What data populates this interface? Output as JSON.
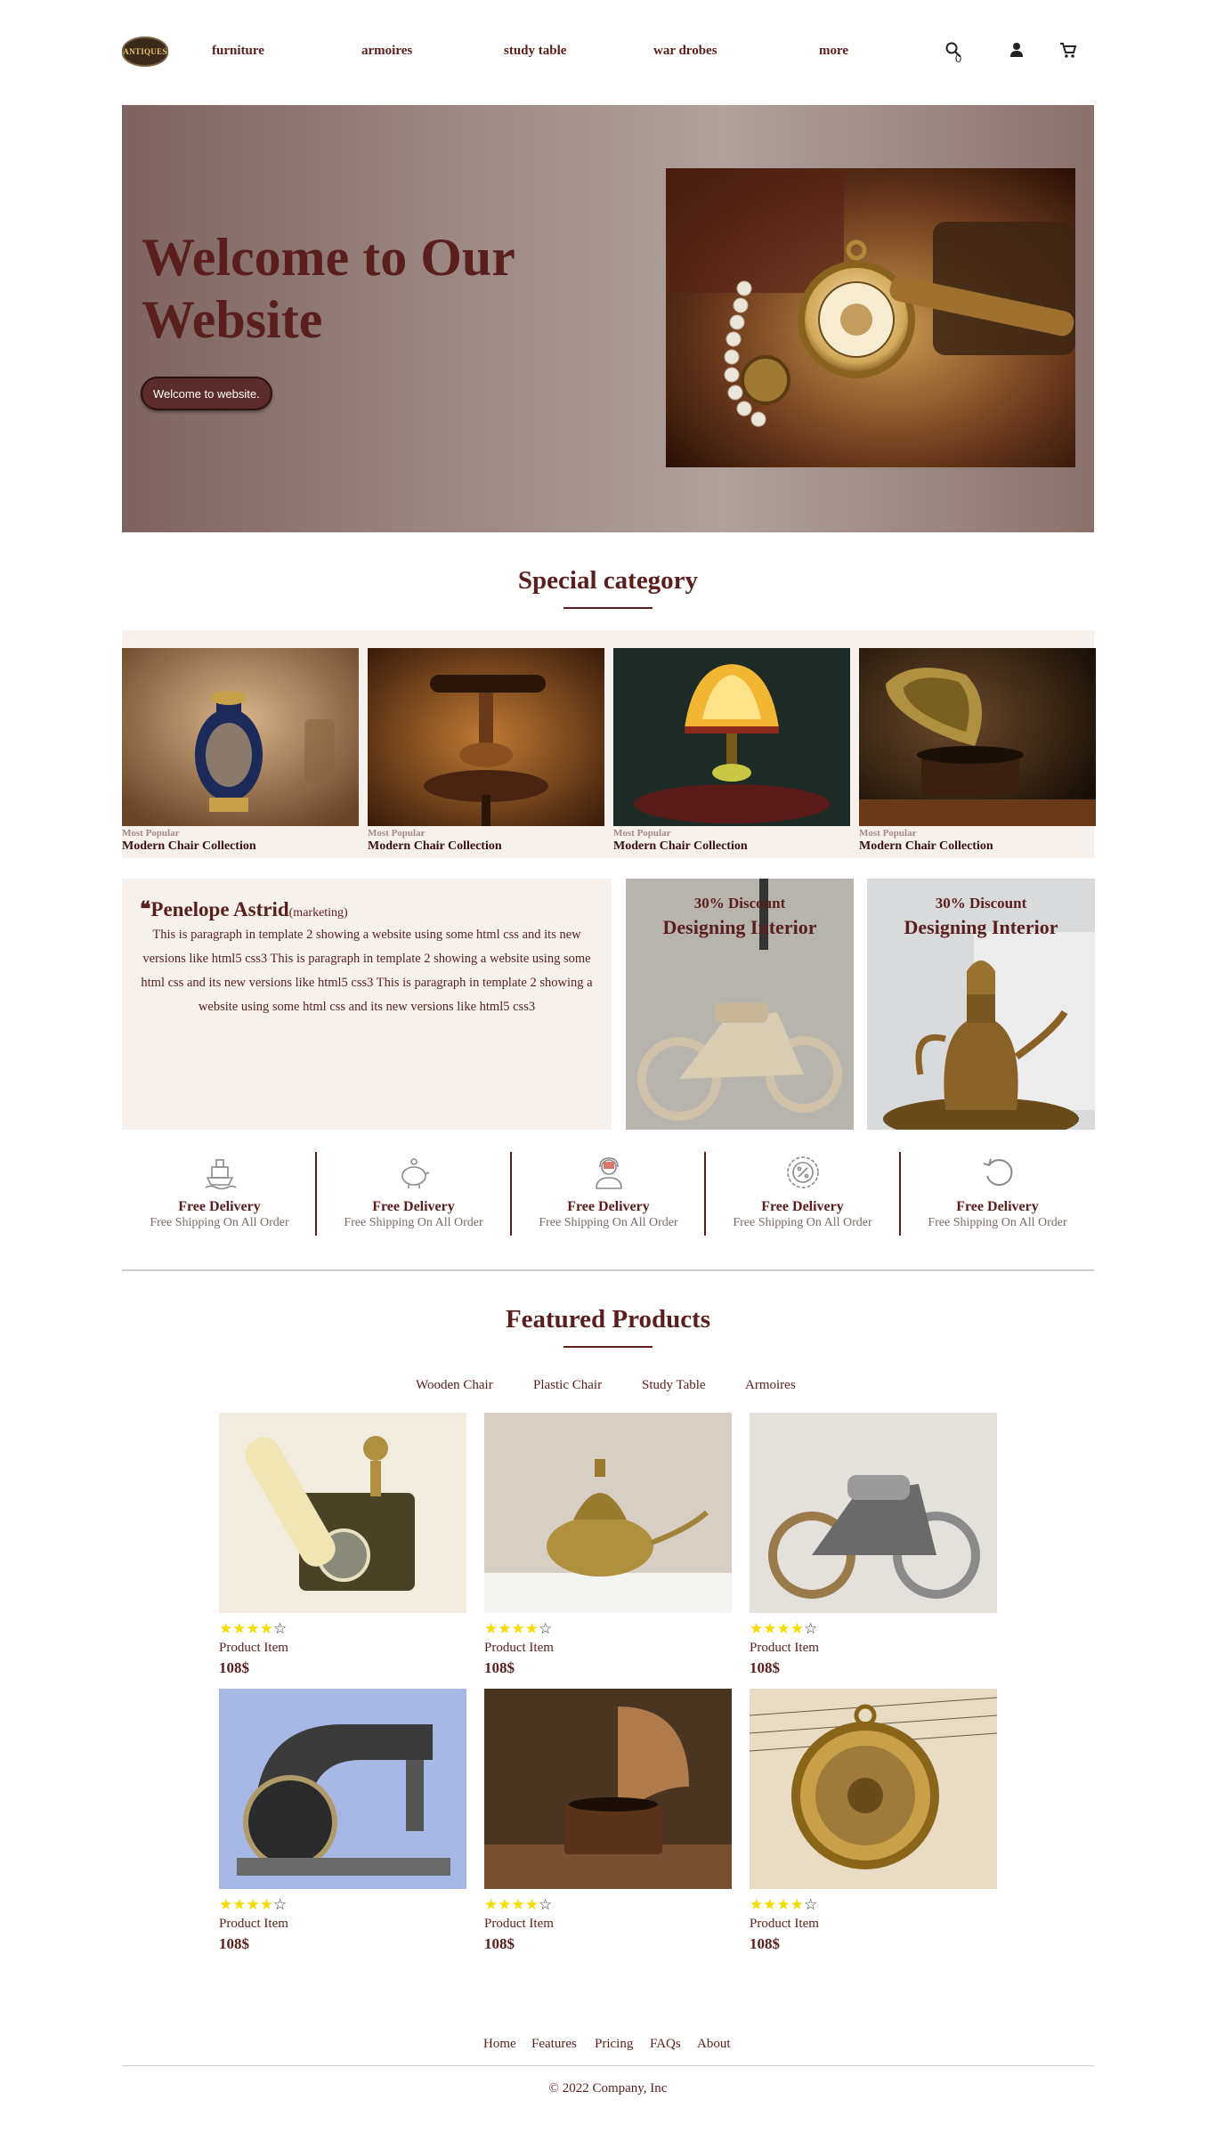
{
  "header": {
    "logo_text": "ANTIQUES",
    "nav": [
      "furniture",
      "armoires",
      "study table",
      "war drobes",
      "more"
    ],
    "cart_count": "0",
    "icons": [
      "search-icon",
      "user-icon",
      "cart-icon"
    ]
  },
  "hero": {
    "title": "Welcome to Our Website",
    "button": "Welcome to website."
  },
  "special": {
    "title": "Special category",
    "cards": [
      {
        "sub": "Most Popular",
        "name": "Modern Chair Collection"
      },
      {
        "sub": "Most Popular",
        "name": "Modern Chair Collection"
      },
      {
        "sub": "Most Popular",
        "name": "Modern Chair Collection"
      },
      {
        "sub": "Most Popular",
        "name": "Modern Chair Collection"
      }
    ]
  },
  "testimonial": {
    "name": "Penelope Astrid",
    "role": "(marketing)",
    "text": "This is paragraph in template 2 showing a website using some html css and its new versions like html5 css3 This is paragraph in template 2 showing a website using some html css and its new versions like html5 css3 This is paragraph in template 2 showing a website using some html css and its new versions like html5 css3"
  },
  "promos": [
    {
      "discount": "30% Discount",
      "title": "Designing Interior"
    },
    {
      "discount": "30% Discount",
      "title": "Designing Interior"
    }
  ],
  "features": [
    {
      "icon": "ship-icon",
      "title": "Free Delivery",
      "sub": "Free Shipping On All Order"
    },
    {
      "icon": "piggy-bank-icon",
      "title": "Free Delivery",
      "sub": "Free Shipping On All Order"
    },
    {
      "icon": "support-agent-icon",
      "title": "Free Delivery",
      "sub": "Free Shipping On All Order"
    },
    {
      "icon": "discount-badge-icon",
      "title": "Free Delivery",
      "sub": "Free Shipping On All Order"
    },
    {
      "icon": "return-arrow-icon",
      "title": "Free Delivery",
      "sub": "Free Shipping On All Order"
    }
  ],
  "featured": {
    "title": "Featured Products",
    "tabs": [
      "Wooden Chair",
      "Plastic Chair",
      "Study Table",
      "Armoires"
    ],
    "products": [
      {
        "name": "Product Item",
        "price": "108$",
        "rating": 4
      },
      {
        "name": "Product Item",
        "price": "108$",
        "rating": 4
      },
      {
        "name": "Product Item",
        "price": "108$",
        "rating": 4
      },
      {
        "name": "Product Item",
        "price": "108$",
        "rating": 4
      },
      {
        "name": "Product Item",
        "price": "108$",
        "rating": 4
      },
      {
        "name": "Product Item",
        "price": "108$",
        "rating": 4
      }
    ]
  },
  "footer": {
    "links": [
      "Home",
      "Features",
      "Pricing",
      "FAQs",
      "About"
    ],
    "copyright": "© 2022 Company, Inc"
  },
  "colors": {
    "brand": "#5a1e1e",
    "band": "#f6f1ed",
    "star": "#f4dc00"
  }
}
